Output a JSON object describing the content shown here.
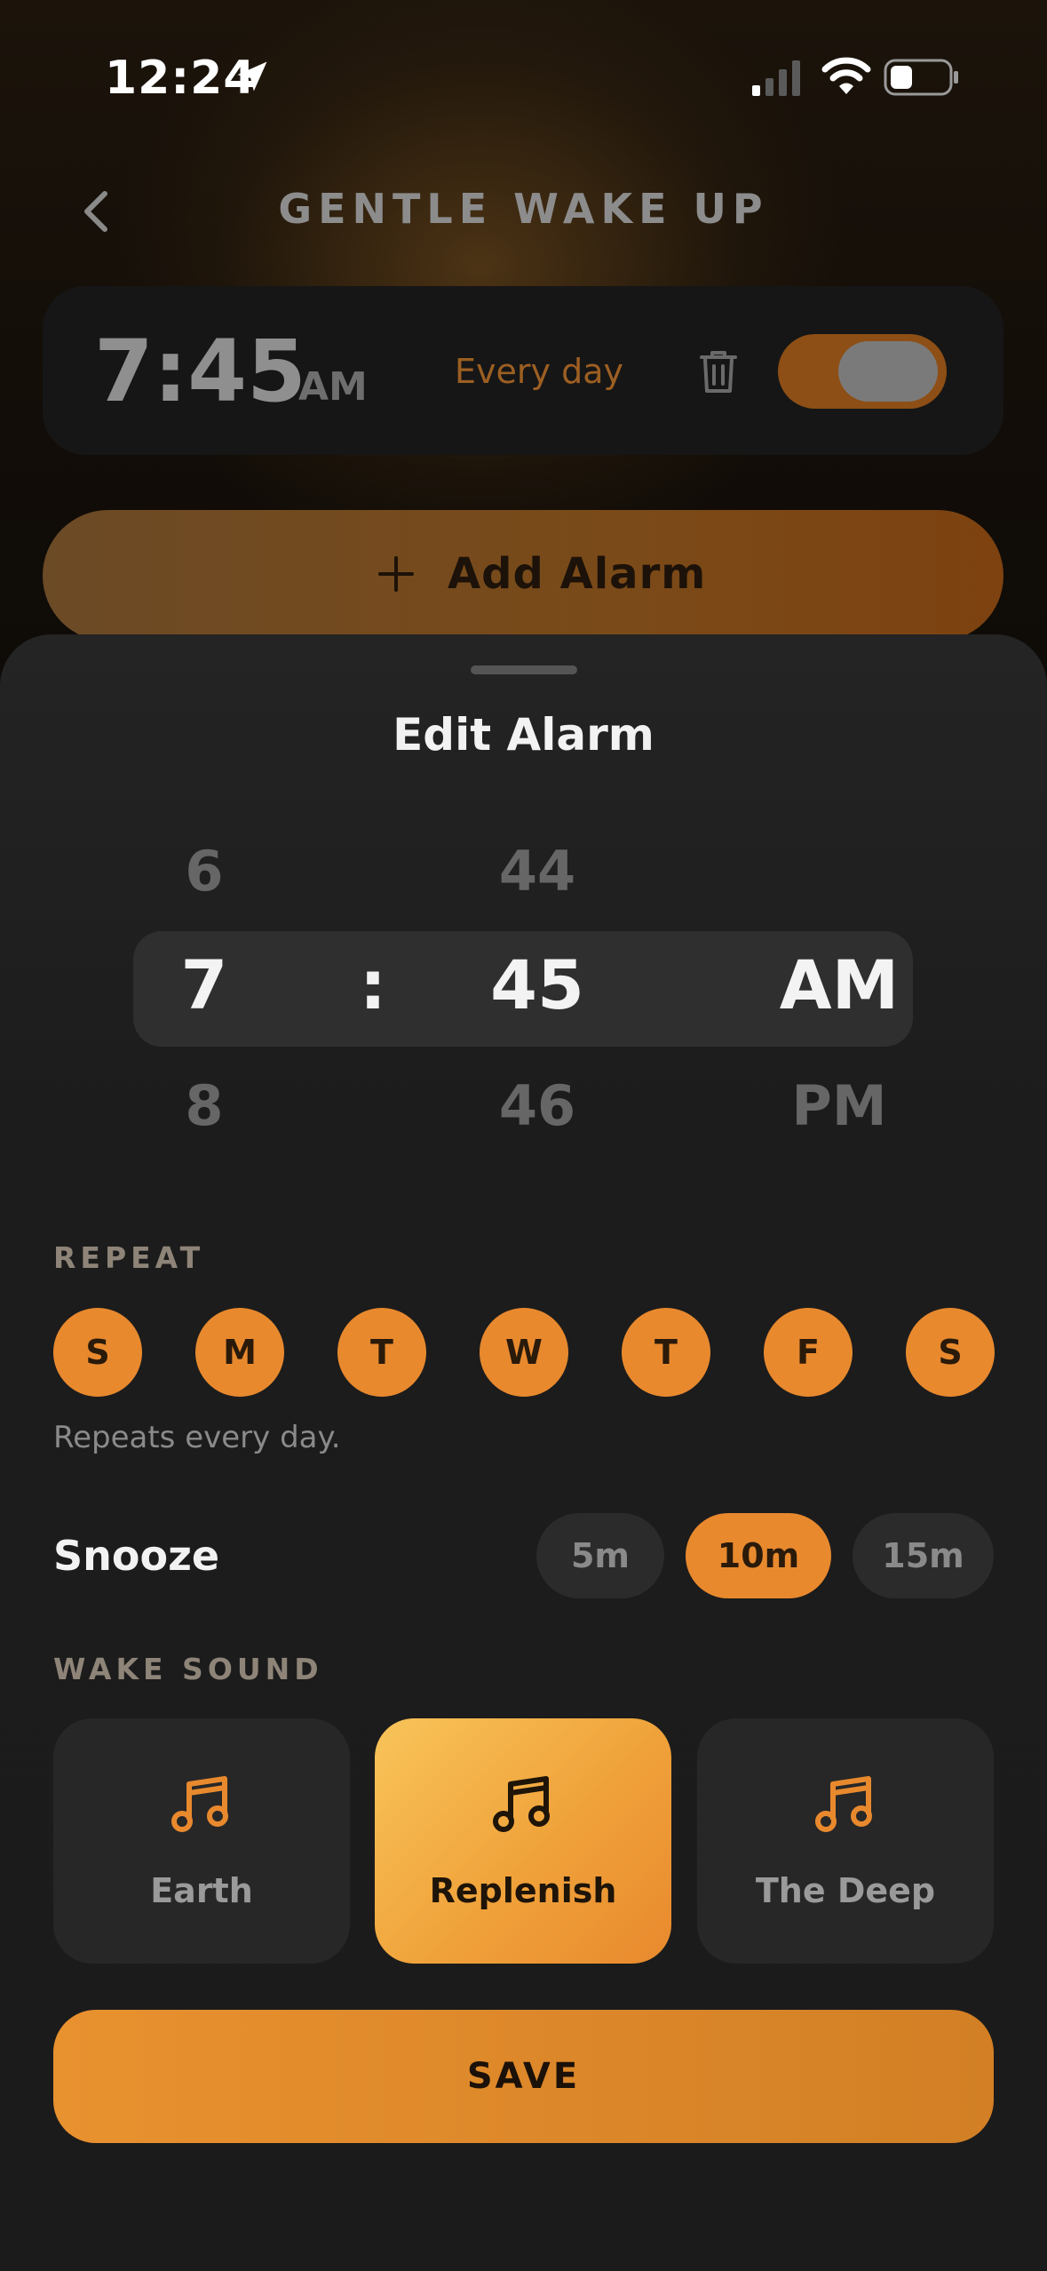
{
  "status_bar": {
    "time": "12:24"
  },
  "header": {
    "title": "GENTLE WAKE UP"
  },
  "alarm": {
    "time": "7:45",
    "ampm": "AM",
    "repeat": "Every day",
    "enabled": true
  },
  "add_alarm": {
    "label": "Add Alarm"
  },
  "sheet": {
    "title": "Edit Alarm",
    "picker": {
      "hour_prev": "6",
      "hour": "7",
      "hour_next": "8",
      "separator": ":",
      "minute_prev": "44",
      "minute": "45",
      "minute_next": "46",
      "period": "AM",
      "period_next": "PM"
    },
    "repeat": {
      "label": "REPEAT",
      "days": [
        "S",
        "M",
        "T",
        "W",
        "T",
        "F",
        "S"
      ],
      "note": "Repeats every day."
    },
    "snooze": {
      "label": "Snooze",
      "options": [
        "5m",
        "10m",
        "15m"
      ],
      "selected": "10m"
    },
    "wake_sound": {
      "label": "WAKE SOUND",
      "options": [
        "Earth",
        "Replenish",
        "The Deep"
      ],
      "selected": "Replenish"
    },
    "save_label": "SAVE"
  },
  "colors": {
    "accent": "#e8892e",
    "sound_active": "#f0a23a",
    "background": "#1a1a1a"
  }
}
